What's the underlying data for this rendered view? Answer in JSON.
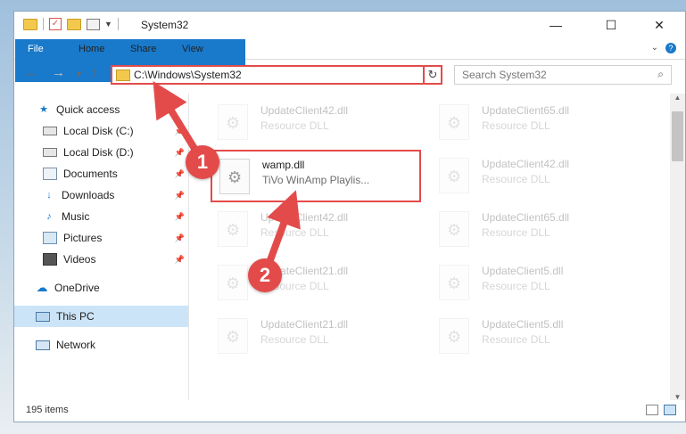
{
  "window": {
    "title": "System32",
    "controls": {
      "minimize": "—",
      "maximize": "☐",
      "close": "✕"
    }
  },
  "ribbon": {
    "tabs": [
      "File",
      "Home",
      "Share",
      "View"
    ]
  },
  "address": {
    "path": "C:\\Windows\\System32",
    "search_placeholder": "Search System32"
  },
  "nav": {
    "items": [
      {
        "label": "Quick access",
        "icon": "star-icon",
        "pinned": false
      },
      {
        "label": "Local Disk (C:)",
        "icon": "drive-icon",
        "pinned": true
      },
      {
        "label": "Local Disk (D:)",
        "icon": "drive-icon",
        "pinned": true
      },
      {
        "label": "Documents",
        "icon": "documents-icon",
        "pinned": true
      },
      {
        "label": "Downloads",
        "icon": "download-icon",
        "pinned": true
      },
      {
        "label": "Music",
        "icon": "music-icon",
        "pinned": true
      },
      {
        "label": "Pictures",
        "icon": "pictures-icon",
        "pinned": true
      },
      {
        "label": "Videos",
        "icon": "videos-icon",
        "pinned": true
      },
      {
        "label": "OneDrive",
        "icon": "cloud-icon",
        "pinned": false
      },
      {
        "label": "This PC",
        "icon": "computer-icon",
        "pinned": false,
        "selected": true
      },
      {
        "label": "Network",
        "icon": "network-icon",
        "pinned": false
      }
    ]
  },
  "files": {
    "highlighted": {
      "name": "wamp.dll",
      "desc": "TiVo WinAmp Playlis..."
    },
    "left_column": [
      {
        "name": "UpdateClient42.dll",
        "desc": "Resource DLL"
      },
      {
        "name": "UpdateClient42.dll",
        "desc": "Resource DLL"
      },
      {
        "name": "UpdateClient21.dll",
        "desc": "Resource DLL"
      },
      {
        "name": "UpdateClient21.dll",
        "desc": "Resource DLL"
      }
    ],
    "right_column": [
      {
        "name": "UpdateClient65.dll",
        "desc": "Resource DLL"
      },
      {
        "name": "UpdateClient42.dll",
        "desc": "Resource DLL"
      },
      {
        "name": "UpdateClient65.dll",
        "desc": "Resource DLL"
      },
      {
        "name": "UpdateClient5.dll",
        "desc": "Resource DLL"
      },
      {
        "name": "UpdateClient5.dll",
        "desc": "Resource DLL"
      }
    ]
  },
  "status": {
    "item_count": "195 items"
  },
  "callouts": {
    "step1": "1",
    "step2": "2"
  },
  "colors": {
    "accent": "#1979ca",
    "callout": "#e34b4b",
    "selection": "#cce4f7"
  }
}
